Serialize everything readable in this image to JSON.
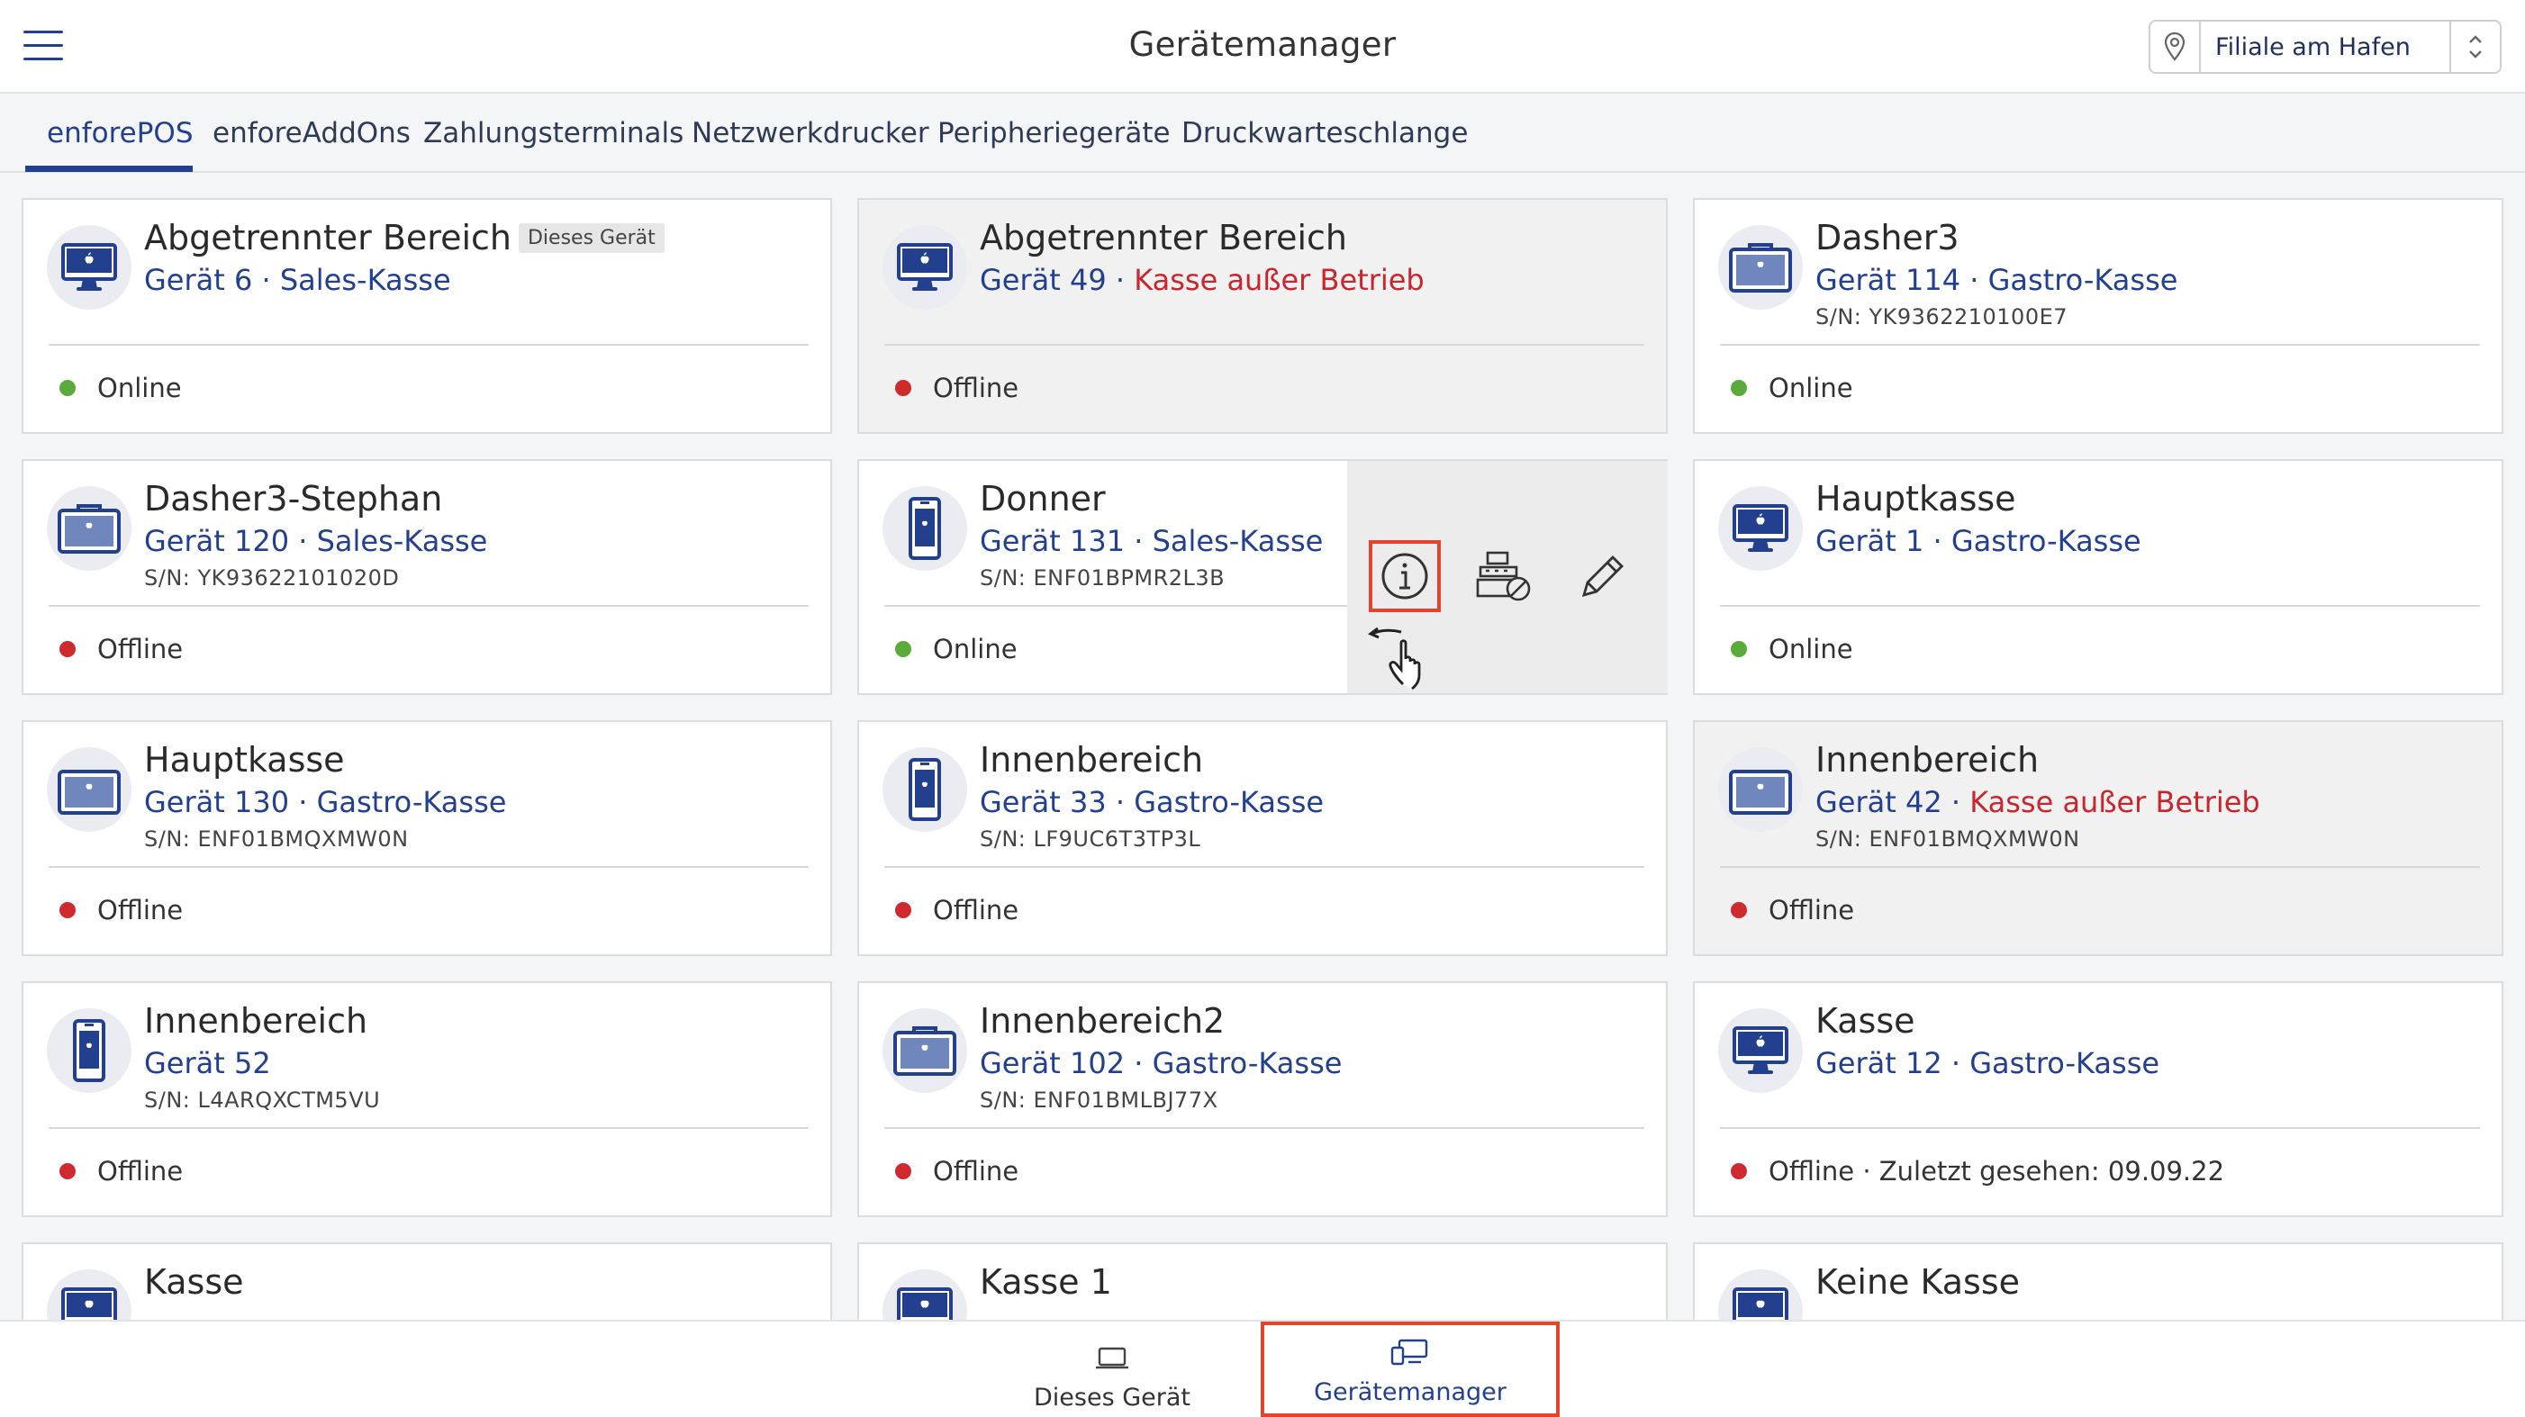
{
  "header": {
    "title": "Gerätemanager",
    "branch": "Filiale am Hafen"
  },
  "tabs": [
    {
      "label": "enforePOS",
      "active": true
    },
    {
      "label": "enforeAddOns"
    },
    {
      "label": "Zahlungsterminals"
    },
    {
      "label": "Netzwerkdrucker"
    },
    {
      "label": "Peripheriegeräte"
    },
    {
      "label": "Druckwarteschlange"
    }
  ],
  "devices": [
    {
      "name": "Abgetrennter Bereich",
      "tag": "Dieses Gerät",
      "sub": "Gerät 6 · Sales-Kasse",
      "status": "Online",
      "icon": "imac-icon"
    },
    {
      "name": "Abgetrennter Bereich",
      "sub": "Gerät 49 · ",
      "sub_alert": "Kasse außer Betrieb",
      "status": "Offline",
      "icon": "imac-icon"
    },
    {
      "name": "Dasher3",
      "sub": "Gerät 114 · Gastro-Kasse",
      "sn": "S/N: YK9362210100E7",
      "status": "Online",
      "icon": "tablet-pos-icon"
    },
    {
      "name": "Dasher3-Stephan",
      "sub": "Gerät 120 · Sales-Kasse",
      "sn": "S/N: YK93622101020D",
      "status": "Offline",
      "icon": "tablet-pos-icon"
    },
    {
      "name": "Donner",
      "sub": "Gerät 131 · Sales-Kasse",
      "sn": "S/N: ENF01BPMR2L3B",
      "status": "Online",
      "icon": "handheld-icon"
    },
    {
      "name": "Hauptkasse",
      "sub": "Gerät 1 · Gastro-Kasse",
      "status": "Online",
      "icon": "imac-icon"
    },
    {
      "name": "Hauptkasse",
      "sub": "Gerät 130 · Gastro-Kasse",
      "sn": "S/N: ENF01BMQXMW0N",
      "status": "Offline",
      "icon": "tablet-pos-icon"
    },
    {
      "name": "Innenbereich",
      "sub": "Gerät 33 · Gastro-Kasse",
      "sn": "S/N: LF9UC6T3TP3L",
      "status": "Offline",
      "icon": "handheld-icon"
    },
    {
      "name": "Innenbereich",
      "sub": "Gerät 42 · ",
      "sub_alert": "Kasse außer Betrieb",
      "sn": "S/N: ENF01BMQXMW0N",
      "status": "Offline",
      "icon": "tablet-pos-icon"
    },
    {
      "name": "Innenbereich",
      "sub": "Gerät 52",
      "sn": "S/N: L4ARQXCTM5VU",
      "status": "Offline",
      "icon": "handheld-icon"
    },
    {
      "name": "Innenbereich2",
      "sub": "Gerät 102 · Gastro-Kasse",
      "sn": "S/N: ENF01BMLBJ77X",
      "status": "Offline",
      "icon": "tablet-pos-icon"
    },
    {
      "name": "Kasse",
      "sub": "Gerät 12 · Gastro-Kasse",
      "status": "Offline · Zuletzt gesehen: 09.09.22",
      "icon": "imac-icon"
    },
    {
      "name": "Kasse",
      "icon": "imac-icon"
    },
    {
      "name": "Kasse 1",
      "icon": "imac-icon"
    },
    {
      "name": "Keine Kasse",
      "icon": "imac-icon"
    }
  ],
  "actions": [
    {
      "name": "info",
      "icon": "info-icon",
      "highlighted": true
    },
    {
      "name": "decommission",
      "icon": "register-disabled-icon"
    },
    {
      "name": "edit",
      "icon": "pencil-icon"
    }
  ],
  "bottom_nav": [
    {
      "label": "Dieses Gerät",
      "icon": "laptop-icon"
    },
    {
      "label": "Gerätemanager",
      "icon": "devices-icon",
      "active": true,
      "highlighted": true
    }
  ],
  "colors": {
    "brand": "#23408e",
    "online": "#5aab3c",
    "offline": "#cf2a2e",
    "alert": "#c9252c",
    "highlight": "#e0452f"
  }
}
